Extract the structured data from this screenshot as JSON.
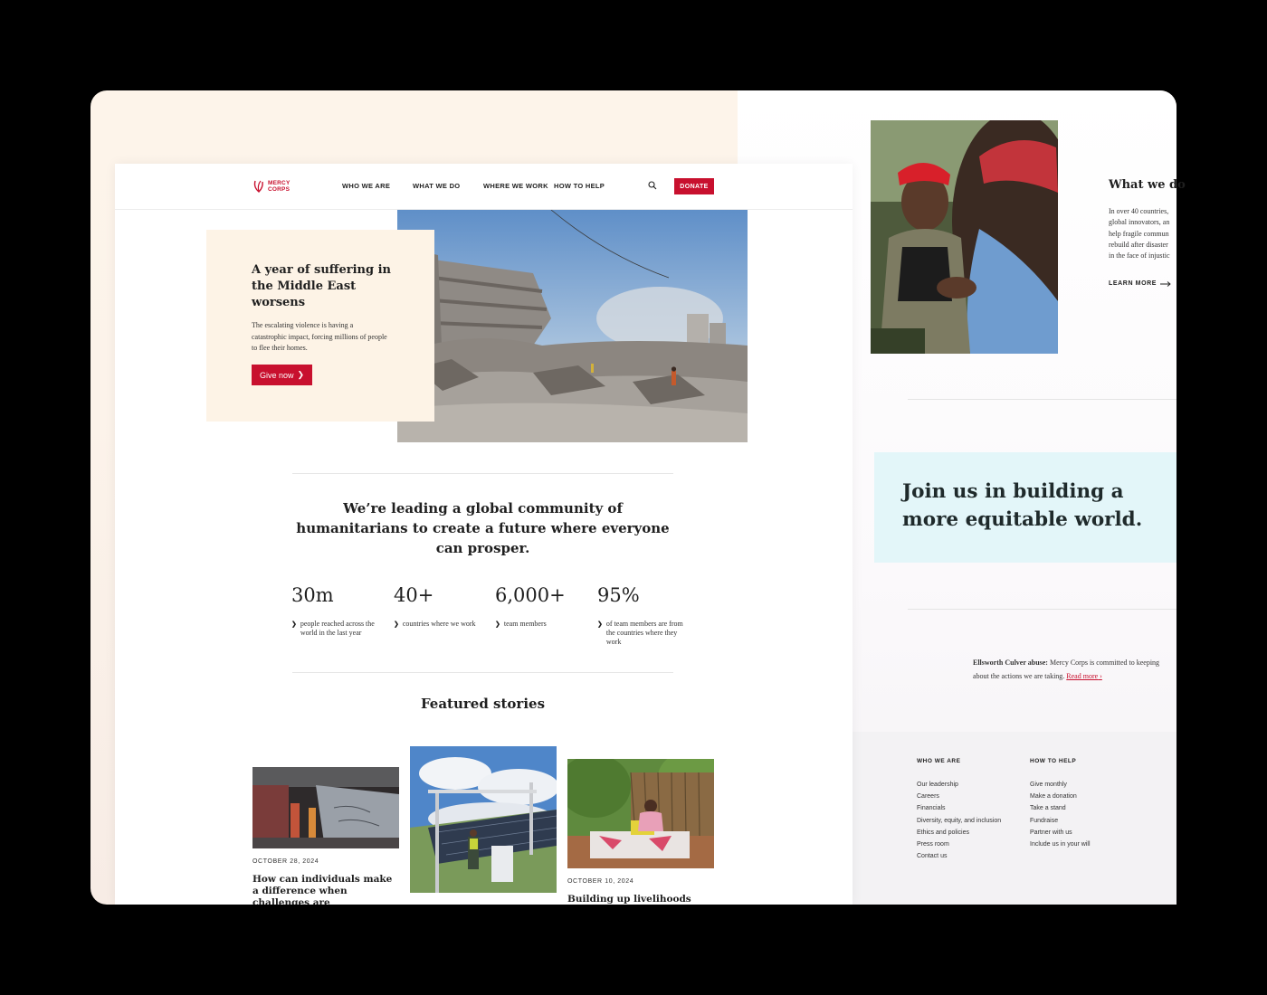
{
  "nav": {
    "logo_line1": "MERCY",
    "logo_line2": "CORPS",
    "items": [
      "WHO WE ARE",
      "WHAT WE DO",
      "WHERE WE WORK",
      "HOW TO HELP"
    ],
    "donate_label": "DONATE",
    "search_icon": "search-icon"
  },
  "hero": {
    "title": "A year of suffering in the Middle East worsens",
    "text": "The escalating violence is having a catastrophic impact, forcing millions of people to flee their homes.",
    "button_label": "Give now"
  },
  "mission": "We’re leading a global community of humanitarians to create a future where everyone can prosper.",
  "stats": [
    {
      "value": "30m",
      "label": "people reached across the world in the last year"
    },
    {
      "value": "40+",
      "label": "countries where we work"
    },
    {
      "value": "6,000+",
      "label": "team members"
    },
    {
      "value": "95%",
      "label": "of team members are from the countries where they work"
    }
  ],
  "featured": {
    "title": "Featured stories",
    "stories": [
      {
        "date": "OCTOBER 28, 2024",
        "title": "How can individuals make a difference when challenges are"
      },
      {
        "date": "",
        "title": ""
      },
      {
        "date": "OCTOBER 10, 2024",
        "title": "Building up livelihoods and"
      }
    ]
  },
  "right": {
    "heading": "What we do",
    "text_lines": [
      "In over 40 countries,",
      "global innovators, an",
      "help fragile commun",
      "rebuild after disaster",
      "in the face of injustic"
    ],
    "learn_more": "LEARN MORE",
    "join": "Join us in building a more equitable world.",
    "abuse_bold": "Ellsworth Culver abuse:",
    "abuse_text": " Mercy Corps is committed to keeping",
    "abuse_line2": "about the actions we are taking.",
    "read_more": "Read more"
  },
  "footer": {
    "col1": {
      "heading": "WHO WE ARE",
      "links": [
        "Our leadership",
        "Careers",
        "Financials",
        "Diversity, equity, and inclusion",
        "Ethics and policies",
        "Press room",
        "Contact us"
      ]
    },
    "col2": {
      "heading": "HOW TO HELP",
      "links": [
        "Give monthly",
        "Make a donation",
        "Take a stand",
        "Fundraise",
        "Partner with us",
        "Include us in your will"
      ]
    }
  },
  "colors": {
    "brand_red": "#c8102e",
    "hero_card": "#fdf3e6",
    "join_box": "#e3f6f9"
  }
}
